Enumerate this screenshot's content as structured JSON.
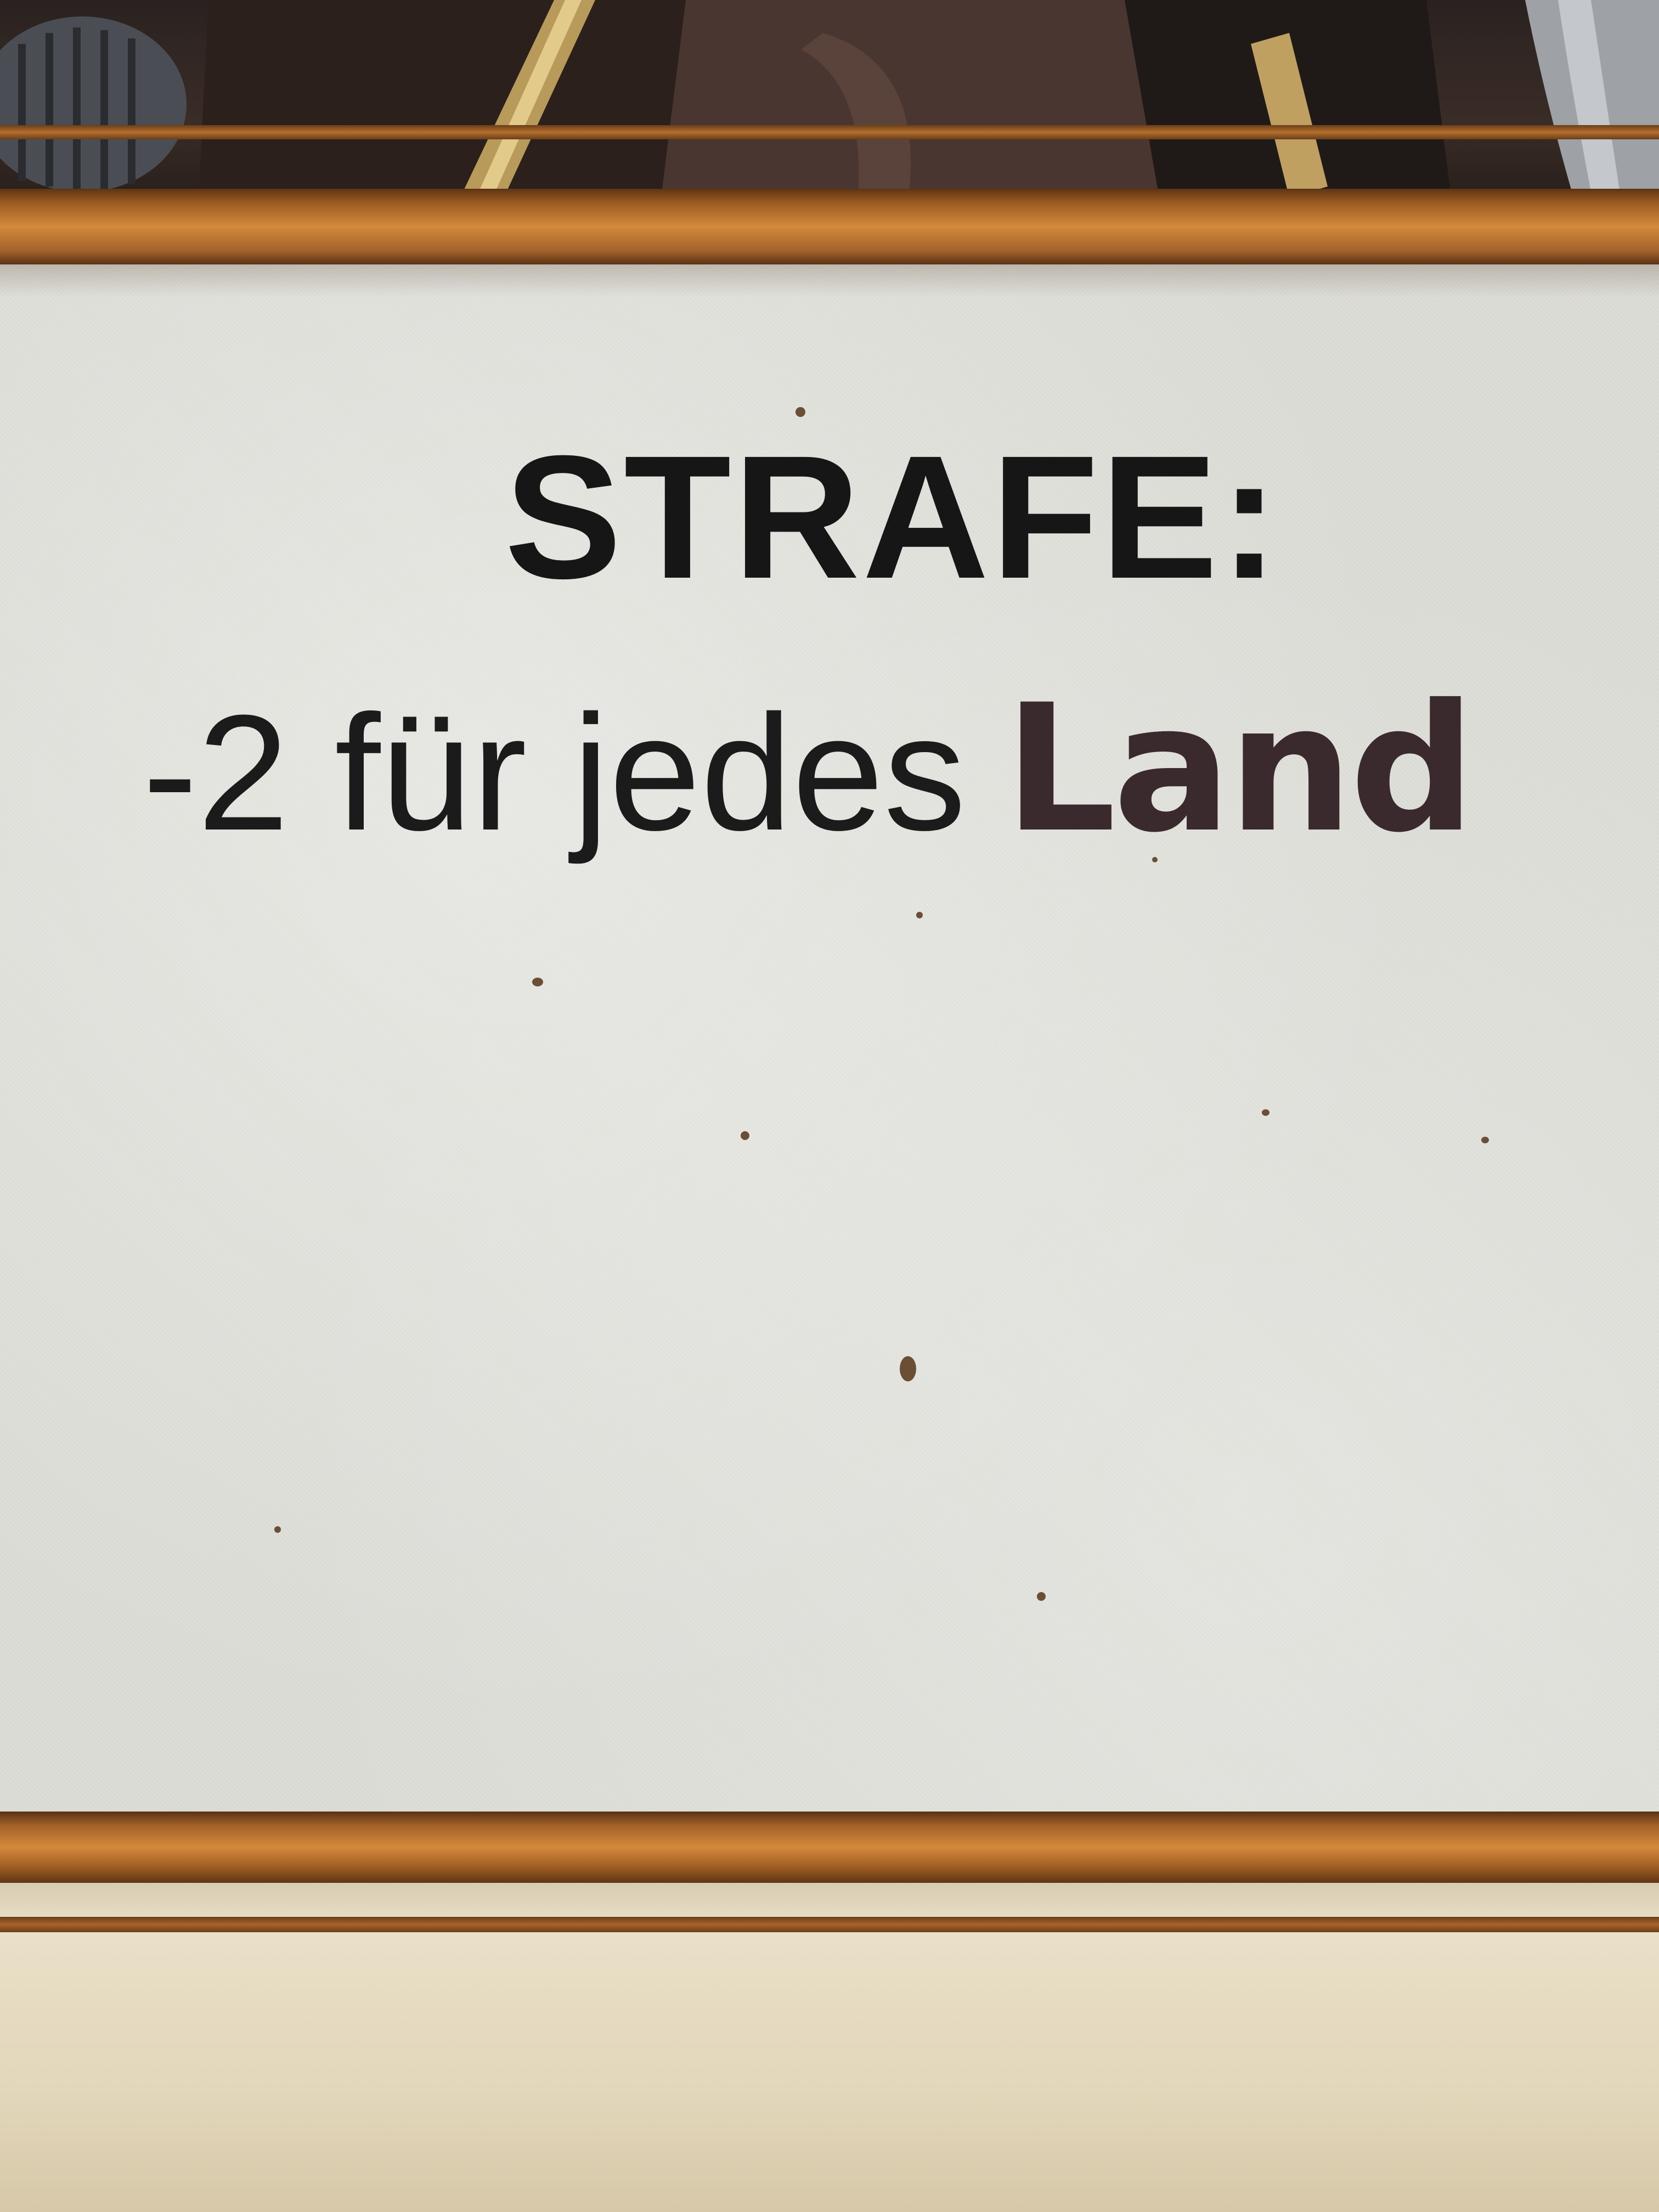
{
  "card": {
    "heading": "STRAFE:",
    "rule_prefix": "-2 für jedes",
    "rule_keyword": "Land"
  }
}
